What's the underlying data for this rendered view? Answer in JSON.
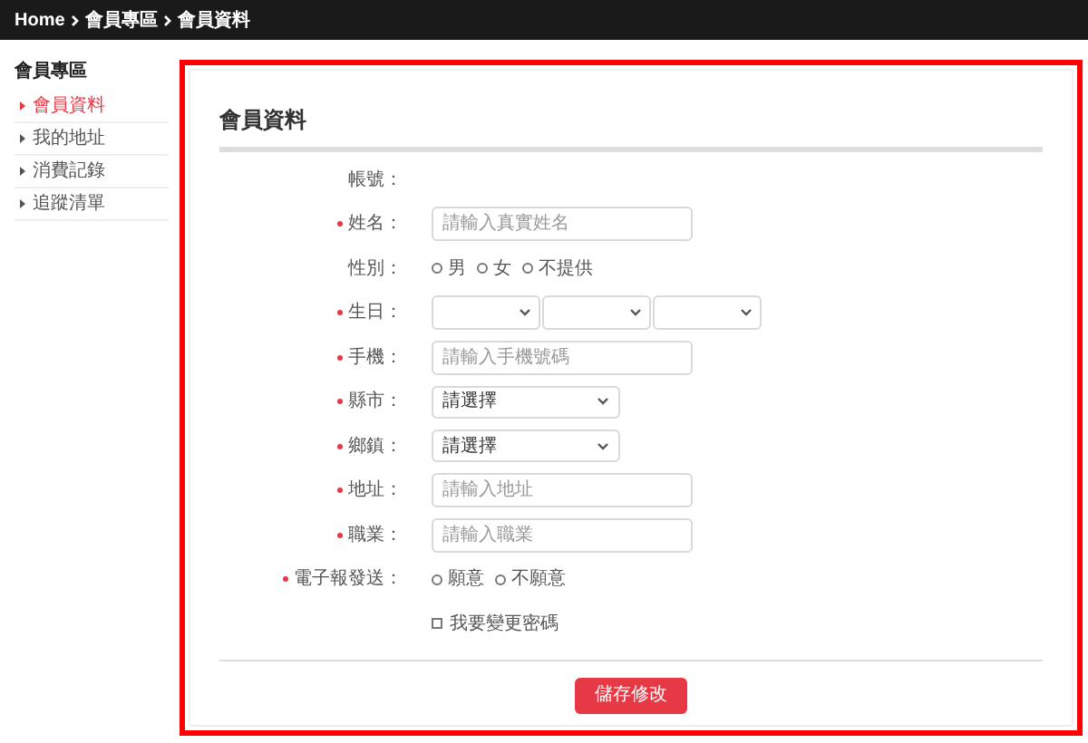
{
  "breadcrumb": [
    {
      "label": "Home"
    },
    {
      "label": "會員專區"
    },
    {
      "label": "會員資料"
    }
  ],
  "sidebar": {
    "title": "會員專區",
    "items": [
      {
        "label": "會員資料",
        "selected": true
      },
      {
        "label": "我的地址",
        "selected": false
      },
      {
        "label": "消費記錄",
        "selected": false
      },
      {
        "label": "追蹤清單",
        "selected": false
      }
    ]
  },
  "form": {
    "title": "會員資料",
    "rows": [
      {
        "kind": "static",
        "label": "帳號：",
        "required": false
      },
      {
        "kind": "input",
        "label": "姓名：",
        "required": true,
        "placeholder": "請輸入真實姓名"
      },
      {
        "kind": "radio",
        "label": "性別：",
        "required": false,
        "options": [
          {
            "label": "男",
            "selected": false
          },
          {
            "label": "女",
            "selected": false
          },
          {
            "label": "不提供",
            "selected": false
          }
        ]
      },
      {
        "kind": "date",
        "label": "生日：",
        "required": true
      },
      {
        "kind": "input",
        "label": "手機：",
        "required": true,
        "placeholder": "請輸入手機號碼"
      },
      {
        "kind": "select",
        "label": "縣市：",
        "required": true,
        "value": "請選擇"
      },
      {
        "kind": "select",
        "label": "鄉鎮：",
        "required": true,
        "value": "請選擇"
      },
      {
        "kind": "input",
        "label": "地址：",
        "required": true,
        "placeholder": "請輸入地址"
      },
      {
        "kind": "input",
        "label": "職業：",
        "required": true,
        "placeholder": "請輸入職業"
      },
      {
        "kind": "radio",
        "label": "電子報發送：",
        "required": true,
        "options": [
          {
            "label": "願意",
            "selected": false
          },
          {
            "label": "不願意",
            "selected": false
          }
        ]
      },
      {
        "kind": "checkbox",
        "label": "我要變更密碼",
        "checked": false
      }
    ],
    "submit": "儲存修改"
  }
}
